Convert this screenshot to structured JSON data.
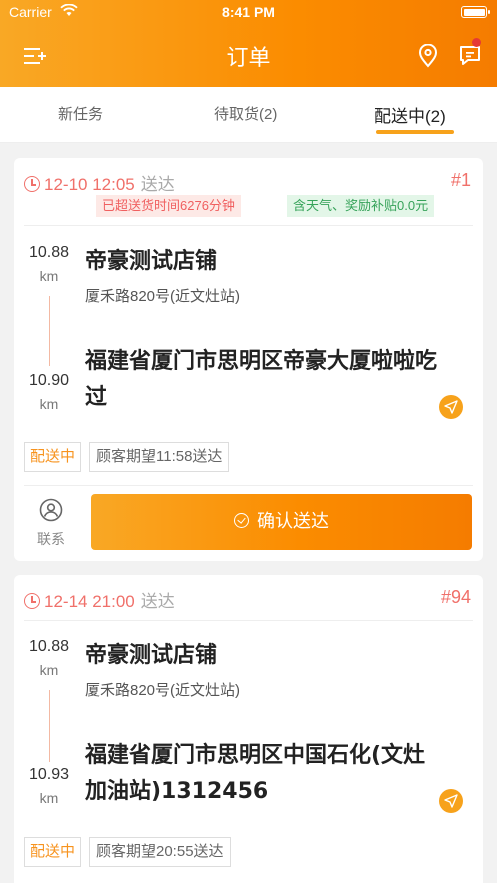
{
  "status_bar": {
    "carrier": "Carrier",
    "time": "8:41 PM"
  },
  "nav": {
    "title": "订单"
  },
  "tabs": [
    {
      "label": "新任务"
    },
    {
      "label": "待取货(2)"
    },
    {
      "label": "配送中(2)"
    }
  ],
  "orders": [
    {
      "time": "12-10 12:05",
      "time_suffix": "送达",
      "number": "#1",
      "overtime_badge": "已超送货时间6276分钟",
      "subsidy_badge": "含天气、奖励补贴0.0元",
      "shop_distance": "10.88",
      "shop_unit": "km",
      "shop_name": "帝豪测试店铺",
      "shop_address": "厦禾路820号(近文灶站)",
      "dest_distance": "10.90",
      "dest_unit": "km",
      "dest_address": "福建省厦门市思明区帝豪大厦啦啦吃过",
      "status_tag": "配送中",
      "expect_tag": "顾客期望11:58送达",
      "contact_label": "联系",
      "confirm_label": "确认送达"
    },
    {
      "time": "12-14 21:00",
      "time_suffix": "送达",
      "number": "#94",
      "shop_distance": "10.88",
      "shop_unit": "km",
      "shop_name": "帝豪测试店铺",
      "shop_address": "厦禾路820号(近文灶站)",
      "dest_distance": "10.93",
      "dest_unit": "km",
      "dest_address": "福建省厦门市思明区中国石化(文灶加油站)1312456",
      "status_tag": "配送中",
      "expect_tag": "顾客期望20:55送达"
    }
  ],
  "colors": {
    "accent": "#f7a21b",
    "danger": "#f0706a",
    "success": "#37a35a"
  }
}
